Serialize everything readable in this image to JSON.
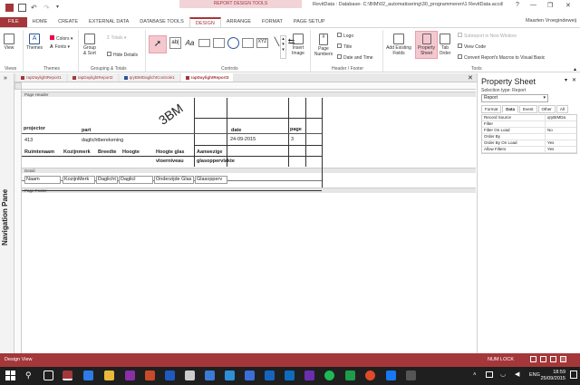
{
  "window": {
    "title": "RevitData : Database- C:\\BIM\\02_automatisering\\30_programmeren\\1 RevitData.accdb (Access 2007 - 2016 file format) - Access",
    "context_tab": "REPORT DESIGN TOOLS",
    "user": "Maarten Vroegindeweij",
    "help": "?",
    "minimize": "—",
    "restore": "❐",
    "close": "✕"
  },
  "ribbon": {
    "tabs": [
      "FILE",
      "HOME",
      "CREATE",
      "EXTERNAL DATA",
      "DATABASE TOOLS",
      "DESIGN",
      "ARRANGE",
      "FORMAT",
      "PAGE SETUP"
    ],
    "active_tab": "DESIGN",
    "view_label": "View",
    "themes_label": "Themes",
    "colors_label": "Colors",
    "fonts_label": "Fonts",
    "group_sort_label": "Group & Sort",
    "totals_label": "Totals",
    "hide_details_label": "Hide Details",
    "insert_image_label": "Insert Image",
    "page_numbers_label": "Page Numbers",
    "logo_label": "Logo",
    "title_label": "Title",
    "date_time_label": "Date and Time",
    "add_fields_label": "Add Existing Fields",
    "property_sheet_label": "Property Sheet",
    "tab_order_label": "Tab Order",
    "subreport_label": "Subreport in New Window",
    "view_code_label": "View Code",
    "convert_label": "Convert Report's Macros to Visual Basic",
    "groups": {
      "views": "Views",
      "themes": "Themes",
      "grouping": "Grouping & Totals",
      "controls": "Controls",
      "header_footer": "Header / Footer",
      "tools": "Tools"
    }
  },
  "doc_tabs": [
    "rapDaylightReport1",
    "rapDaylightReport2",
    "qryBIMDaglichtControle1",
    "rapDaylightReport3"
  ],
  "nav_pane_label": "Navigation Pane",
  "report": {
    "page_header": "Page Header",
    "detail": "Detail",
    "page_footer": "Page Footer",
    "projector_label": "projector",
    "part_label": "part",
    "date_label": "date",
    "page_label": "page",
    "project_value": "413",
    "part_value": "daglichtberekening",
    "date_value": "24-09-2015",
    "page_value": "3",
    "logo_text": "3BM",
    "col_headers": [
      "Ruimtenaam",
      "Kozijnmerk",
      "Breedte",
      "Hoogte",
      "Hoogte glas",
      "Aanwezige"
    ],
    "col_headers2": [
      "vloerniveau",
      "glasoppervlakte"
    ],
    "detail_fields": [
      "Naam",
      "KozijnMerk",
      "Daglicht",
      "Daglicl",
      "Onderzijde Glas",
      "Glasopperv"
    ]
  },
  "property_sheet": {
    "title": "Property Sheet",
    "selection_label": "Selection type: Report",
    "selected": "Report",
    "tabs": [
      "Format",
      "Data",
      "Event",
      "Other",
      "All"
    ],
    "active_tab": "Data",
    "rows": [
      {
        "name": "Record Source",
        "value": "qryBIMDa"
      },
      {
        "name": "Filter",
        "value": ""
      },
      {
        "name": "Filter On Load",
        "value": "No"
      },
      {
        "name": "Order By",
        "value": ""
      },
      {
        "name": "Order By On Load",
        "value": "Yes"
      },
      {
        "name": "Allow Filters",
        "value": "Yes"
      }
    ]
  },
  "status": {
    "view": "Design View",
    "num_lock": "NUM LOCK"
  },
  "taskbar": {
    "time": "18:59",
    "date": "25/09/2015",
    "lang": "ENG"
  },
  "colors": {
    "accent": "#a4373a"
  }
}
